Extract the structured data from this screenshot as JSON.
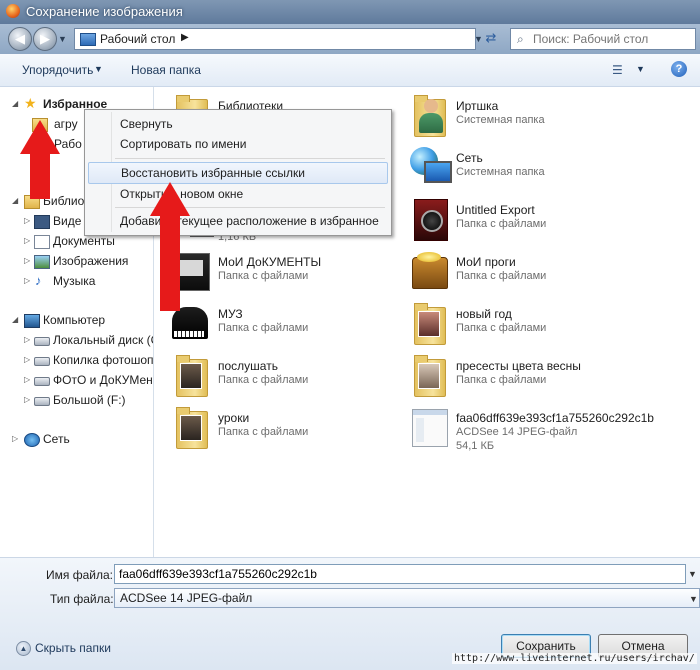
{
  "window": {
    "title": "Сохранение изображения"
  },
  "address_bar": {
    "location": "Рабочий стол",
    "search_placeholder": "Поиск: Рабочий стол"
  },
  "toolbar": {
    "organize": "Упорядочить",
    "new_folder": "Новая папка"
  },
  "nav": {
    "favorites": "Избранное",
    "favorites_partial": [
      "агру",
      "Рабо"
    ],
    "libraries_partial": "Библио",
    "libraries": [
      "Виде",
      "Документы",
      "Изображения",
      "Музыка"
    ],
    "computer": "Компьютер",
    "drives": [
      "Локальный диск (C",
      "Копилка фотошопа",
      "ФОтО и ДоКУМенты",
      "Большой (F:)"
    ],
    "network": "Сеть"
  },
  "context_menu": {
    "items": [
      "Свернуть",
      "Сортировать по имени",
      "Восстановить избранные ссылки",
      "Открыть в новом окне",
      "Добавить текущее расположение в избранное"
    ],
    "highlighted_index": 2
  },
  "files": [
    {
      "name": "Библиотеки",
      "type": "",
      "size": "",
      "icon": "folder-icon"
    },
    {
      "name": "Иртшка",
      "type": "Системная папка",
      "size": "",
      "icon": "user-folder-icon"
    },
    {
      "name": "",
      "type": "",
      "size": "",
      "icon": "folder-icon"
    },
    {
      "name": "Сеть",
      "type": "Системная папка",
      "size": "",
      "icon": "network-icon"
    },
    {
      "name": "",
      "type": "",
      "size": "1,16 КБ",
      "icon": "shortcut-icon"
    },
    {
      "name": "Untitled Export",
      "type": "Папка с файлами",
      "size": "",
      "icon": "camera-folder-icon"
    },
    {
      "name": "МоИ ДоКУМЕНТЫ",
      "type": "Папка с файлами",
      "size": "",
      "icon": "documents-folder-icon"
    },
    {
      "name": "МоИ проги",
      "type": "Папка с файлами",
      "size": "",
      "icon": "treasure-folder-icon"
    },
    {
      "name": "МУЗ",
      "type": "Папка с файлами",
      "size": "",
      "icon": "piano-folder-icon"
    },
    {
      "name": "новый год",
      "type": "Папка с файлами",
      "size": "",
      "icon": "photo-folder-icon"
    },
    {
      "name": "послушать",
      "type": "Папка с файлами",
      "size": "",
      "icon": "photo-folder-icon"
    },
    {
      "name": "пресесты цвета весны",
      "type": "Папка с файлами",
      "size": "",
      "icon": "photo-folder-icon"
    },
    {
      "name": "уроки",
      "type": "Папка с файлами",
      "size": "",
      "icon": "photo-folder-icon"
    },
    {
      "name": "faa06dff639e393cf1a755260c292c1b",
      "type": "ACDSee 14 JPEG-файл",
      "size": "54,1 КБ",
      "icon": "image-file-icon"
    }
  ],
  "form": {
    "filename_label": "Имя файла:",
    "filename_value": "faa06dff639e393cf1a755260c292c1b",
    "filetype_label": "Тип файла:",
    "filetype_value": "ACDSee 14 JPEG-файл"
  },
  "footer": {
    "hide_folders": "Скрыть папки",
    "save": "Сохранить",
    "cancel": "Отмена",
    "watermark": "http://www.liveinternet.ru/users/irchav/"
  }
}
